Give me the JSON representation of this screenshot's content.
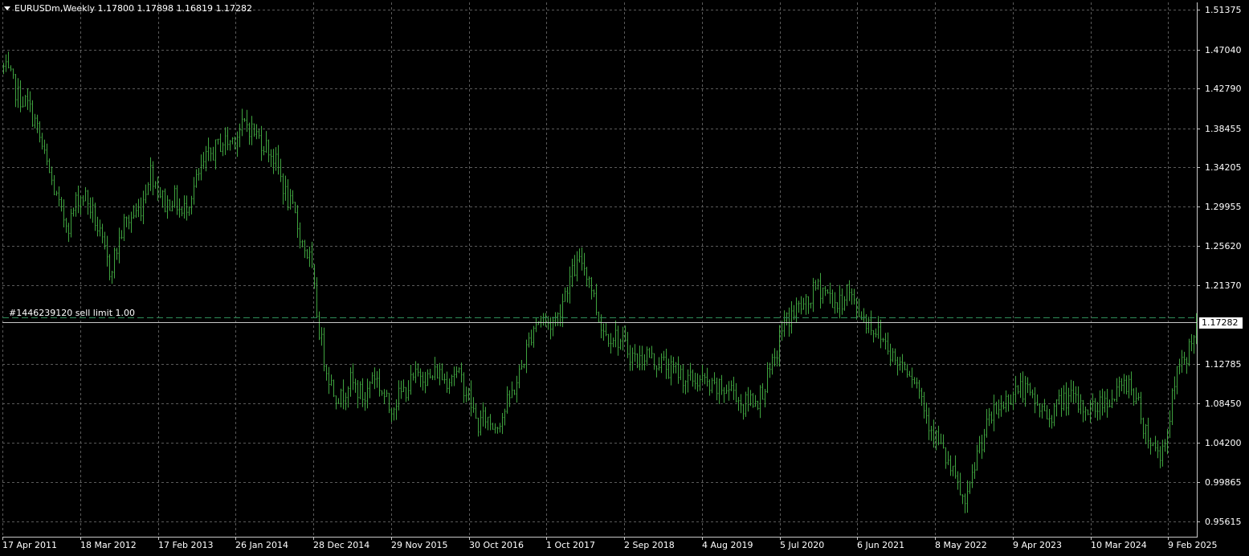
{
  "symbol_header": {
    "text": "EURUSDm,Weekly  1.17800 1.17898 1.16819 1.17282"
  },
  "pending_order": {
    "label": "#1446239120 sell limit 1.00",
    "price": 1.1787
  },
  "current_price": "1.17282",
  "price_scale": {
    "min": 0.95615,
    "max": 1.51375,
    "labels": [
      "1.51375",
      "1.47040",
      "1.42790",
      "1.38455",
      "1.34205",
      "1.29955",
      "1.25620",
      "1.21370",
      "1.12785",
      "1.08450",
      "1.04200",
      "0.99865",
      "0.95615"
    ]
  },
  "time_scale": {
    "labels": [
      "17 Apr 2011",
      "18 Mar 2012",
      "17 Feb 2013",
      "26 Jan 2014",
      "28 Dec 2014",
      "29 Nov 2015",
      "30 Oct 2016",
      "1 Oct 2017",
      "2 Sep 2018",
      "4 Aug 2019",
      "5 Jul 2020",
      "6 Jun 2021",
      "8 May 2022",
      "9 Apr 2023",
      "10 Mar 2024",
      "9 Feb 2025"
    ]
  },
  "colors": {
    "background": "#000000",
    "bars": "#3fa33f",
    "grid": "#5a5a5a",
    "axis": "#c8c8c8",
    "order_line": "#2e8b57"
  }
}
